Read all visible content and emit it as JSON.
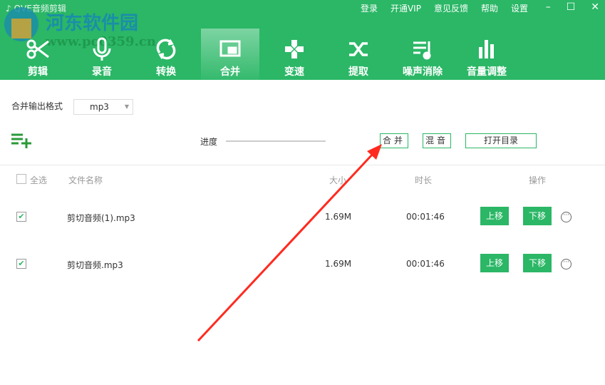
{
  "app": {
    "title": "QVE音频剪辑"
  },
  "watermark": {
    "line1": "河东软件园",
    "line2": "www.pc0359.cn"
  },
  "topmenu": [
    "登录",
    "开通VIP",
    "意见反馈",
    "帮助",
    "设置"
  ],
  "window": {
    "minimize": "–",
    "maximize": "☐",
    "close": "✕"
  },
  "tabs": [
    {
      "label": "剪辑",
      "icon": "scissors-icon"
    },
    {
      "label": "录音",
      "icon": "microphone-icon"
    },
    {
      "label": "转换",
      "icon": "refresh-icon"
    },
    {
      "label": "合并",
      "icon": "merge-icon",
      "active": true
    },
    {
      "label": "变速",
      "icon": "gamepad-icon"
    },
    {
      "label": "提取",
      "icon": "shuffle-icon"
    },
    {
      "label": "噪声消除",
      "icon": "music-list-icon"
    },
    {
      "label": "音量调整",
      "icon": "bar-chart-icon"
    }
  ],
  "format": {
    "label": "合并输出格式",
    "value": "mp3"
  },
  "progress": {
    "label": "进度",
    "value": 0
  },
  "actions": {
    "merge": "合并",
    "mix": "混音",
    "open_dir": "打开目录"
  },
  "table": {
    "select_all": "全选",
    "headers": {
      "name": "文件名称",
      "size": "大小",
      "duration": "时长",
      "ops": "操作"
    },
    "rows": [
      {
        "checked": true,
        "name": "剪切音频(1).mp3",
        "size": "1.69M",
        "duration": "00:01:46",
        "up": "上移",
        "down": "下移"
      },
      {
        "checked": true,
        "name": "剪切音频.mp3",
        "size": "1.69M",
        "duration": "00:01:46",
        "up": "上移",
        "down": "下移"
      }
    ]
  },
  "colors": {
    "brand": "#2bb766",
    "arrow": "#ff2a1f"
  }
}
